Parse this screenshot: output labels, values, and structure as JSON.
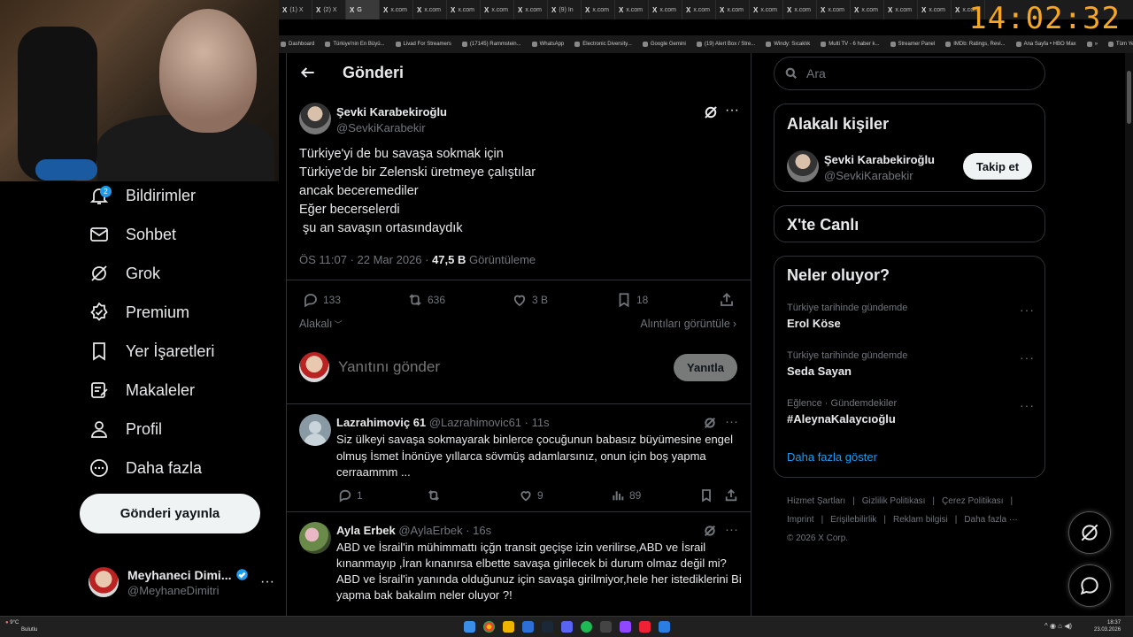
{
  "clock": "14:02:32",
  "browser": {
    "tabs": [
      "(1) X",
      "(2) X",
      "G",
      "x.com",
      "x.com",
      "x.com",
      "x.com",
      "x.com",
      "(9) In",
      "x.com",
      "x.com",
      "x.com",
      "x.com",
      "x.com",
      "x.com",
      "x.com",
      "x.com",
      "x.com",
      "x.com",
      "x.com",
      "x.com"
    ],
    "bookmarks": [
      "Dashboard",
      "Türkiye'nin En Büyü...",
      "Livad For Streamers",
      "(17145) Rammstein...",
      "WhatsApp",
      "Electronic Diversity...",
      "Google Gemini",
      "(19) Alert Box / Stre...",
      "Windy: Sıcaklık",
      "Multi TV - 6 haber k...",
      "Streamer Panel",
      "IMDb: Ratings, Revi...",
      "Ana Sayfa • HBO Max",
      "»",
      "Tüm Yer İşaretleri"
    ]
  },
  "sidebar": {
    "notifications_badge": "2",
    "items": [
      {
        "label": "Bildirimler",
        "icon": "bell-icon"
      },
      {
        "label": "Sohbet",
        "icon": "mail-icon"
      },
      {
        "label": "Grok",
        "icon": "grok-icon"
      },
      {
        "label": "Premium",
        "icon": "premium-icon"
      },
      {
        "label": "Yer İşaretleri",
        "icon": "bookmark-icon"
      },
      {
        "label": "Makaleler",
        "icon": "article-icon"
      },
      {
        "label": "Profil",
        "icon": "profile-icon"
      },
      {
        "label": "Daha fazla",
        "icon": "more-circle-icon"
      }
    ],
    "post_button": "Gönderi yayınla",
    "account": {
      "name": "Meyhaneci Dimi...",
      "handle": "@MeyhaneDimitri"
    }
  },
  "header": {
    "title": "Gönderi"
  },
  "post": {
    "author_name": "Şevki Karabekiroğlu",
    "author_handle": "@SevkiKarabekir",
    "lines": [
      "Türkiye'yi de bu savaşa sokmak için",
      "Türkiye'de bir Zelenski üretmeye çalıştılar",
      "ancak beceremediler",
      "Eğer becerselerdi",
      " şu an savaşın ortasındaydık"
    ],
    "time": "ÖS 11:07 · 22 Mar 2026 ·",
    "views": "47,5 B",
    "views_label": "Görüntüleme",
    "replies": "133",
    "reposts": "636",
    "likes": "3 B",
    "bookmarks": "18",
    "sort_label": "Alakalı",
    "quotes_label": "Alıntıları görüntüle"
  },
  "composer": {
    "placeholder": "Yanıtını gönder",
    "reply_button": "Yanıtla"
  },
  "replies": [
    {
      "name": "Lazrahimoviç 61",
      "handle": "@Lazrahimovic61",
      "time": "· 11s",
      "text": "Siz ülkeyi savaşa sokmayarak binlerce çocuğunun babasız büyümesine engel olmuş İsmet İnönüye yıllarca sövmüş adamlarsınız, onun için boş yapma cerraammm  ...",
      "replies": "1",
      "reposts": "",
      "likes": "9",
      "views": "89"
    },
    {
      "name": "Ayla Erbek",
      "handle": "@AylaErbek",
      "time": "· 16s",
      "text": "ABD ve İsrail'in mühimmattı içğn transit geçişe izin verilirse,ABD ve İsrail kınanmayıp ,İran kınanırsa elbette savaşa girilecek bi durum olmaz değil mi? ABD ve İsrail'in yanında olduğunuz için savaşa girilmiyor,hele her istediklerini Bi yapma bak bakalım neler oluyor ?!"
    }
  ],
  "right": {
    "search_placeholder": "Ara",
    "related_title": "Alakalı kişiler",
    "related_name": "Şevki Karabekiroğlu",
    "related_handle": "@SevkiKarabekir",
    "follow_button": "Takip et",
    "live_title": "X'te Canlı",
    "trends_title": "Neler oluyor?",
    "trends": [
      {
        "context": "Türkiye tarihinde gündemde",
        "term": "Erol Köse"
      },
      {
        "context": "Türkiye tarihinde gündemde",
        "term": "Seda Sayan"
      },
      {
        "context": "Eğlence · Gündemdekiler",
        "term": "#AleynaKalaycıoğlu"
      }
    ],
    "show_more": "Daha fazla göster",
    "footer": [
      "Hizmet Şartları",
      "|",
      "Gizlilik Politikası",
      "|",
      "Çerez Politikası",
      "|",
      "Imprint",
      "|",
      "Erişilebilirlik",
      "|",
      "Reklam bilgisi",
      "|",
      "Daha fazla ···",
      "© 2026 X Corp."
    ]
  },
  "taskbar": {
    "weather_temp": "9°C",
    "weather_desc": "Bulutlu",
    "time": "18:37",
    "date": "23.03.2026"
  },
  "colors": {
    "accent": "#1d9bf0",
    "clock": "#f5a623",
    "border": "#2f3336",
    "muted": "#71767b"
  }
}
